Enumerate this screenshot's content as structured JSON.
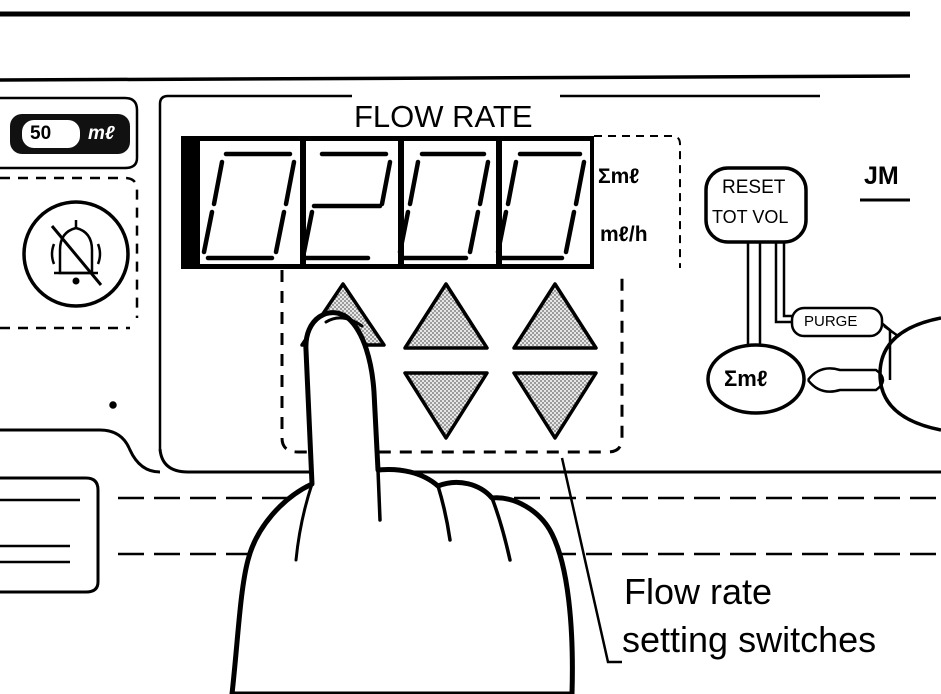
{
  "syringe": {
    "size_value": "50",
    "size_unit": "mℓ"
  },
  "panel": {
    "title": "FLOW RATE",
    "brand_fragment": "JM"
  },
  "display": {
    "digits": [
      "0",
      "2",
      "0",
      "0"
    ],
    "unit_total": "Σmℓ",
    "unit_rate": "mℓ/h"
  },
  "buttons": {
    "reset_line1": "RESET",
    "reset_line2": "TOT VOL",
    "purge": "PURGE",
    "total": "Σmℓ"
  },
  "callout": {
    "line1": "Flow rate",
    "line2": "setting switches"
  },
  "icons": [
    "alarm-silence-icon",
    "increment-arrow-icon",
    "decrement-arrow-icon",
    "pressing-finger-hand"
  ],
  "colors": {
    "ink": "#000000",
    "paper": "#ffffff",
    "key_fill": "#cfcfcf"
  }
}
